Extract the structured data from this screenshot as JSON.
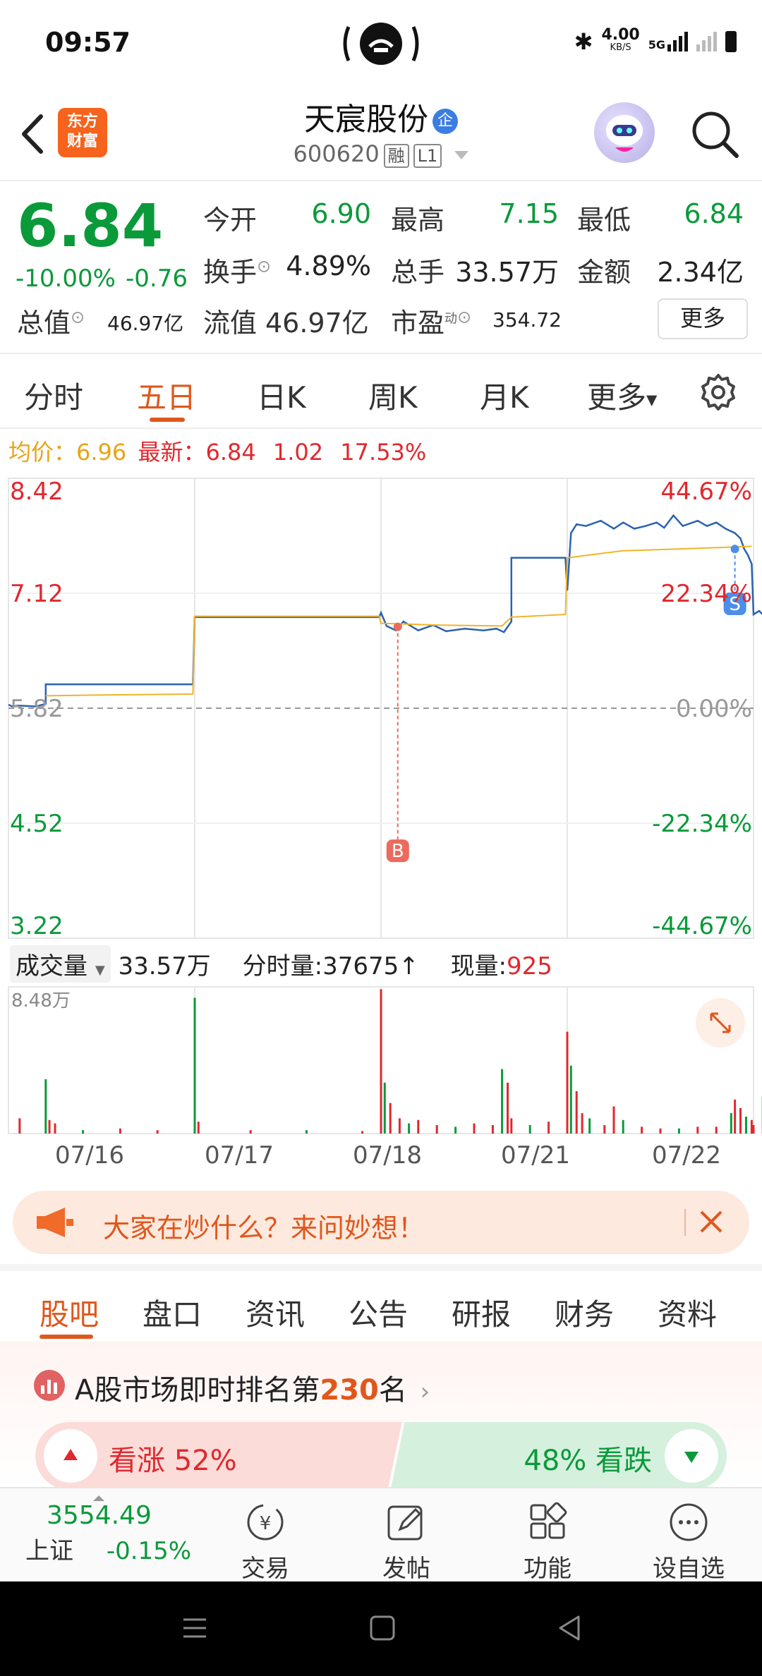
{
  "status": {
    "time": "09:57",
    "net_speed": "4.00",
    "net_unit": "KB/S",
    "signal": "5G"
  },
  "header": {
    "logo_line1": "东方",
    "logo_line2": "财富",
    "title": "天宸股份",
    "title_badge": "企",
    "code": "600620",
    "tag_rong": "融",
    "tag_level": "L1"
  },
  "quote": {
    "price": "6.84",
    "pct_change": "-10.00%",
    "abs_change": "-0.76",
    "open_label": "今开",
    "open": "6.90",
    "high_label": "最高",
    "high": "7.15",
    "low_label": "最低",
    "low": "6.84",
    "turnover_label": "换手",
    "turnover": "4.89%",
    "volume_label": "总手",
    "volume": "33.57万",
    "amount_label": "金额",
    "amount": "2.34亿",
    "mktcap_label": "总值",
    "mktcap": "46.97亿",
    "float_label": "流值",
    "float_cap": "46.97亿",
    "pe_label": "市盈",
    "pe_sup": "动",
    "pe": "354.72",
    "more_button": "更多"
  },
  "ktabs": [
    "分时",
    "五日",
    "日K",
    "周K",
    "月K",
    "更多"
  ],
  "avg_line": {
    "avg_label": "均价：",
    "avg_value": "6.96",
    "latest_label": "最新：",
    "latest_value": "6.84",
    "latest_change": "1.02",
    "latest_pct": "17.53%"
  },
  "chart_data": {
    "type": "line",
    "title": "",
    "x_labels": [
      "07/16",
      "07/17",
      "07/18",
      "07/21",
      "07/22"
    ],
    "y_ticks_left": [
      "8.42",
      "7.12",
      "5.82",
      "4.52",
      "3.22"
    ],
    "y_ticks_right": [
      "44.67%",
      "22.34%",
      "0.00%",
      "-22.34%",
      "-44.67%"
    ],
    "ylim": [
      3.22,
      8.42
    ],
    "base_price": 5.82,
    "series": [
      {
        "name": "",
        "color": "#2b62b0",
        "values": [
          [
            0,
            5.86
          ],
          [
            0.02,
            5.84
          ],
          [
            0.05,
            5.85
          ],
          [
            0.15,
            5.84
          ],
          [
            0.2,
            5.87
          ],
          [
            0.2,
            6.09
          ],
          [
            0.3,
            6.09
          ],
          [
            0.6,
            6.09
          ],
          [
            0.99,
            6.09
          ],
          [
            1.0,
            6.85
          ],
          [
            1.3,
            6.85
          ],
          [
            1.6,
            6.85
          ],
          [
            1.99,
            6.85
          ],
          [
            2.0,
            6.9
          ],
          [
            2.03,
            6.75
          ],
          [
            2.08,
            6.7
          ],
          [
            2.12,
            6.8
          ],
          [
            2.2,
            6.7
          ],
          [
            2.28,
            6.76
          ],
          [
            2.35,
            6.69
          ],
          [
            2.45,
            6.72
          ],
          [
            2.55,
            6.7
          ],
          [
            2.62,
            6.72
          ],
          [
            2.66,
            6.68
          ],
          [
            2.7,
            6.8
          ],
          [
            2.7,
            7.52
          ],
          [
            2.99,
            7.52
          ],
          [
            3.0,
            7.15
          ],
          [
            3.02,
            7.8
          ],
          [
            3.05,
            7.9
          ],
          [
            3.1,
            7.88
          ],
          [
            3.18,
            7.94
          ],
          [
            3.25,
            7.85
          ],
          [
            3.3,
            7.92
          ],
          [
            3.36,
            7.85
          ],
          [
            3.42,
            7.88
          ],
          [
            3.48,
            7.92
          ],
          [
            3.52,
            7.86
          ],
          [
            3.57,
            8.0
          ],
          [
            3.62,
            7.88
          ],
          [
            3.7,
            7.94
          ],
          [
            3.75,
            7.88
          ],
          [
            3.8,
            7.92
          ],
          [
            3.85,
            7.85
          ],
          [
            3.9,
            7.8
          ],
          [
            3.93,
            7.74
          ],
          [
            3.95,
            7.62
          ],
          [
            3.97,
            7.55
          ],
          [
            3.99,
            7.45
          ],
          [
            4.0,
            6.88
          ],
          [
            4.03,
            6.92
          ],
          [
            4.06,
            6.86
          ],
          [
            4.08,
            6.89
          ],
          [
            4.12,
            6.84
          ]
        ]
      },
      {
        "name": "",
        "color": "#f0b429",
        "values": [
          [
            0.2,
            5.96
          ],
          [
            0.5,
            5.97
          ],
          [
            0.99,
            5.98
          ],
          [
            1.0,
            6.86
          ],
          [
            1.99,
            6.86
          ],
          [
            2.0,
            6.78
          ],
          [
            2.3,
            6.76
          ],
          [
            2.65,
            6.75
          ],
          [
            2.7,
            6.85
          ],
          [
            2.99,
            6.88
          ],
          [
            3.0,
            7.52
          ],
          [
            3.3,
            7.6
          ],
          [
            3.6,
            7.62
          ],
          [
            3.99,
            7.65
          ]
        ]
      }
    ],
    "markers": [
      {
        "label": "B",
        "x": 2.09,
        "price": 6.74,
        "color": "#ec6a5e"
      },
      {
        "label": "S",
        "x": 3.9,
        "price": 7.62,
        "color": "#4c8ee8"
      }
    ],
    "volume": {
      "label": "成交量",
      "total": "33.57万",
      "period_label": "分时量:",
      "period_value": "37675↑",
      "current_label": "现量:",
      "current_value": "925",
      "ymax_label": "8.48万",
      "ymax": 84800,
      "bars": [
        [
          0.06,
          9000
        ],
        [
          0.2,
          32000
        ],
        [
          0.22,
          8000
        ],
        [
          0.25,
          6000
        ],
        [
          0.4,
          2000
        ],
        [
          0.6,
          3000
        ],
        [
          0.8,
          2000
        ],
        [
          1.0,
          80000
        ],
        [
          1.02,
          7000
        ],
        [
          1.3,
          2000
        ],
        [
          1.6,
          2000
        ],
        [
          1.9,
          1500
        ],
        [
          2.0,
          85000
        ],
        [
          2.02,
          30000
        ],
        [
          2.05,
          18000
        ],
        [
          2.1,
          9000
        ],
        [
          2.15,
          6000
        ],
        [
          2.2,
          8000
        ],
        [
          2.3,
          5000
        ],
        [
          2.4,
          4000
        ],
        [
          2.5,
          6000
        ],
        [
          2.6,
          5000
        ],
        [
          2.65,
          38000
        ],
        [
          2.68,
          30000
        ],
        [
          2.7,
          9000
        ],
        [
          2.8,
          5000
        ],
        [
          2.9,
          7000
        ],
        [
          3.0,
          60000
        ],
        [
          3.02,
          40000
        ],
        [
          3.05,
          25000
        ],
        [
          3.08,
          12000
        ],
        [
          3.12,
          9000
        ],
        [
          3.2,
          5000
        ],
        [
          3.25,
          16000
        ],
        [
          3.3,
          8000
        ],
        [
          3.4,
          4000
        ],
        [
          3.5,
          3000
        ],
        [
          3.6,
          3000
        ],
        [
          3.7,
          4000
        ],
        [
          3.8,
          4000
        ],
        [
          3.88,
          12000
        ],
        [
          3.9,
          20000
        ],
        [
          3.93,
          15000
        ],
        [
          3.96,
          10000
        ],
        [
          3.99,
          8000
        ],
        [
          4.0,
          5000
        ],
        [
          4.05,
          22000
        ],
        [
          4.1,
          4000
        ],
        [
          4.12,
          8000
        ]
      ]
    }
  },
  "banner": {
    "text": "大家在炒什么？来问妙想！"
  },
  "btabs": [
    "股吧",
    "盘口",
    "资讯",
    "公告",
    "研报",
    "财务",
    "资料"
  ],
  "ranking": {
    "prefix": "A股市场即时排名第",
    "rank": "230",
    "suffix": "名",
    "up_label": "看涨 52%",
    "down_label": "48% 看跌",
    "up_share": 0.52
  },
  "footer": {
    "index_value": "3554.49",
    "index_name": "上证",
    "index_change": "-0.15%",
    "trade": "交易",
    "post": "发帖",
    "features": "功能",
    "watchlist": "设自选"
  }
}
